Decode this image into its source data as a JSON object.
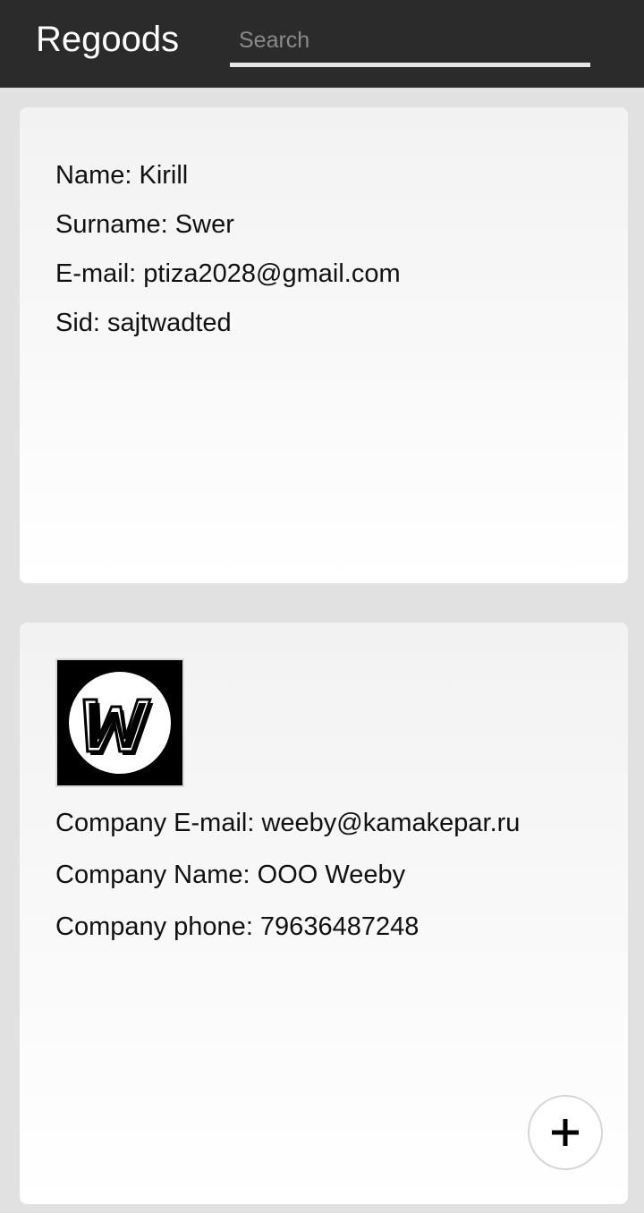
{
  "header": {
    "title": "Regoods",
    "search_placeholder": "Search",
    "background": "#2b2b2b"
  },
  "user_card": {
    "name": "Name: Kirill",
    "surname": "Surname: Swer",
    "email": "E-mail: ptiza2028@gmail.com",
    "sid": "Sid: sajtwadted"
  },
  "company_card": {
    "logo_icon": "weeby-logo-icon",
    "email": "Company E-mail: weeby@kamakepar.ru",
    "name": "Company Name: OOO Weeby",
    "phone": "Company phone: 79636487248"
  },
  "fab": {
    "icon": "plus-icon"
  }
}
